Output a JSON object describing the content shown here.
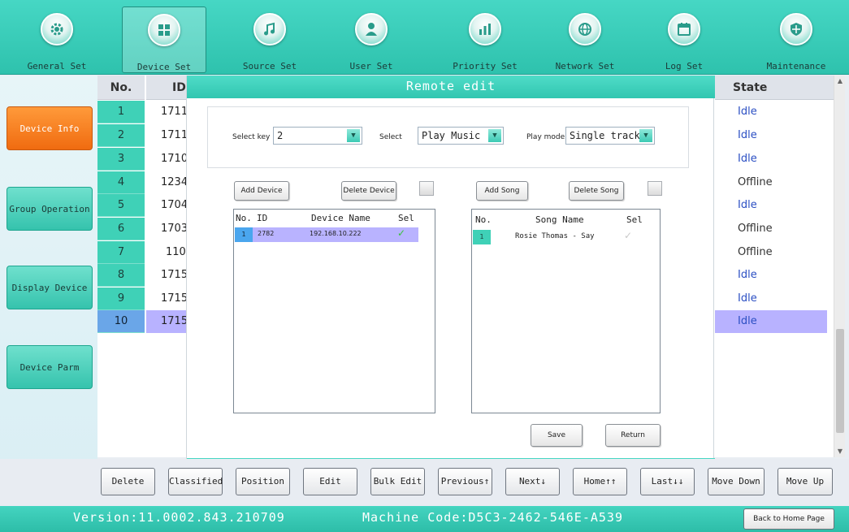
{
  "colors": {
    "accent": "#33c8b2",
    "active_tab": "#f07018",
    "selected_row": "#b8b2ff",
    "idle_text": "#2b4fc3"
  },
  "toolbar": [
    {
      "label": "General Set",
      "icon": "gear-icon"
    },
    {
      "label": "Device Set",
      "icon": "grid-icon"
    },
    {
      "label": "Source Set",
      "icon": "music-note-icon"
    },
    {
      "label": "User Set",
      "icon": "user-icon"
    },
    {
      "label": "Priority Set",
      "icon": "bar-chart-icon"
    },
    {
      "label": "Network Set",
      "icon": "globe-icon"
    },
    {
      "label": "Log Set",
      "icon": "calendar-icon"
    },
    {
      "label": "Maintenance",
      "icon": "shield-icon"
    }
  ],
  "sidebar": [
    {
      "label": "Device Info"
    },
    {
      "label": "Group Operation"
    },
    {
      "label": "Display Device"
    },
    {
      "label": "Device Parm"
    }
  ],
  "table": {
    "headers": {
      "no": "No.",
      "id": "ID",
      "state": "State"
    },
    "rows": [
      {
        "no": "1",
        "id": "1711",
        "state": "Idle"
      },
      {
        "no": "2",
        "id": "1711",
        "state": "Idle"
      },
      {
        "no": "3",
        "id": "1710",
        "state": "Idle"
      },
      {
        "no": "4",
        "id": "1234",
        "state": "Offline"
      },
      {
        "no": "5",
        "id": "1704",
        "state": "Idle"
      },
      {
        "no": "6",
        "id": "1703",
        "state": "Offline"
      },
      {
        "no": "7",
        "id": "110",
        "state": "Offline"
      },
      {
        "no": "8",
        "id": "1715",
        "state": "Idle"
      },
      {
        "no": "9",
        "id": "1715",
        "state": "Idle"
      },
      {
        "no": "10",
        "id": "1715",
        "state": "Idle"
      }
    ],
    "selected_row": 10
  },
  "dialog": {
    "title": "Remote edit",
    "select_key_label": "Select key",
    "select_key_value": "2",
    "select_label": "Select",
    "select_value": "Play Music",
    "play_mode_label": "Play mode",
    "play_mode_value": "Single track",
    "add_device": "Add Device",
    "delete_device": "Delete Device",
    "add_song": "Add Song",
    "delete_song": "Delete Song",
    "device_list": {
      "headers": {
        "no": "No.",
        "id": "ID",
        "name": "Device Name",
        "sel": "Sel"
      },
      "rows": [
        {
          "no": "1",
          "id": "2782",
          "name": "192.168.10.222",
          "sel": "✓"
        }
      ]
    },
    "song_list": {
      "headers": {
        "no": "No.",
        "name": "Song Name",
        "sel": "Sel"
      },
      "rows": [
        {
          "no": "1",
          "name": "Rosie Thomas - Say",
          "sel": "✓"
        }
      ]
    },
    "save": "Save",
    "return": "Return"
  },
  "bottom_buttons": [
    {
      "label": "Delete"
    },
    {
      "label": "Classified"
    },
    {
      "label": "Position"
    },
    {
      "label": "Edit"
    },
    {
      "label": "Bulk Edit"
    },
    {
      "label": "Previous↑"
    },
    {
      "label": "Next↓"
    },
    {
      "label": "Home↑↑"
    },
    {
      "label": "Last↓↓"
    },
    {
      "label": "Move Down"
    },
    {
      "label": "Move Up"
    }
  ],
  "status": {
    "version": "Version:11.0002.843.210709",
    "machine_code": "Machine Code:D5C3-2462-546E-A539",
    "back_home": "Back to Home Page"
  }
}
